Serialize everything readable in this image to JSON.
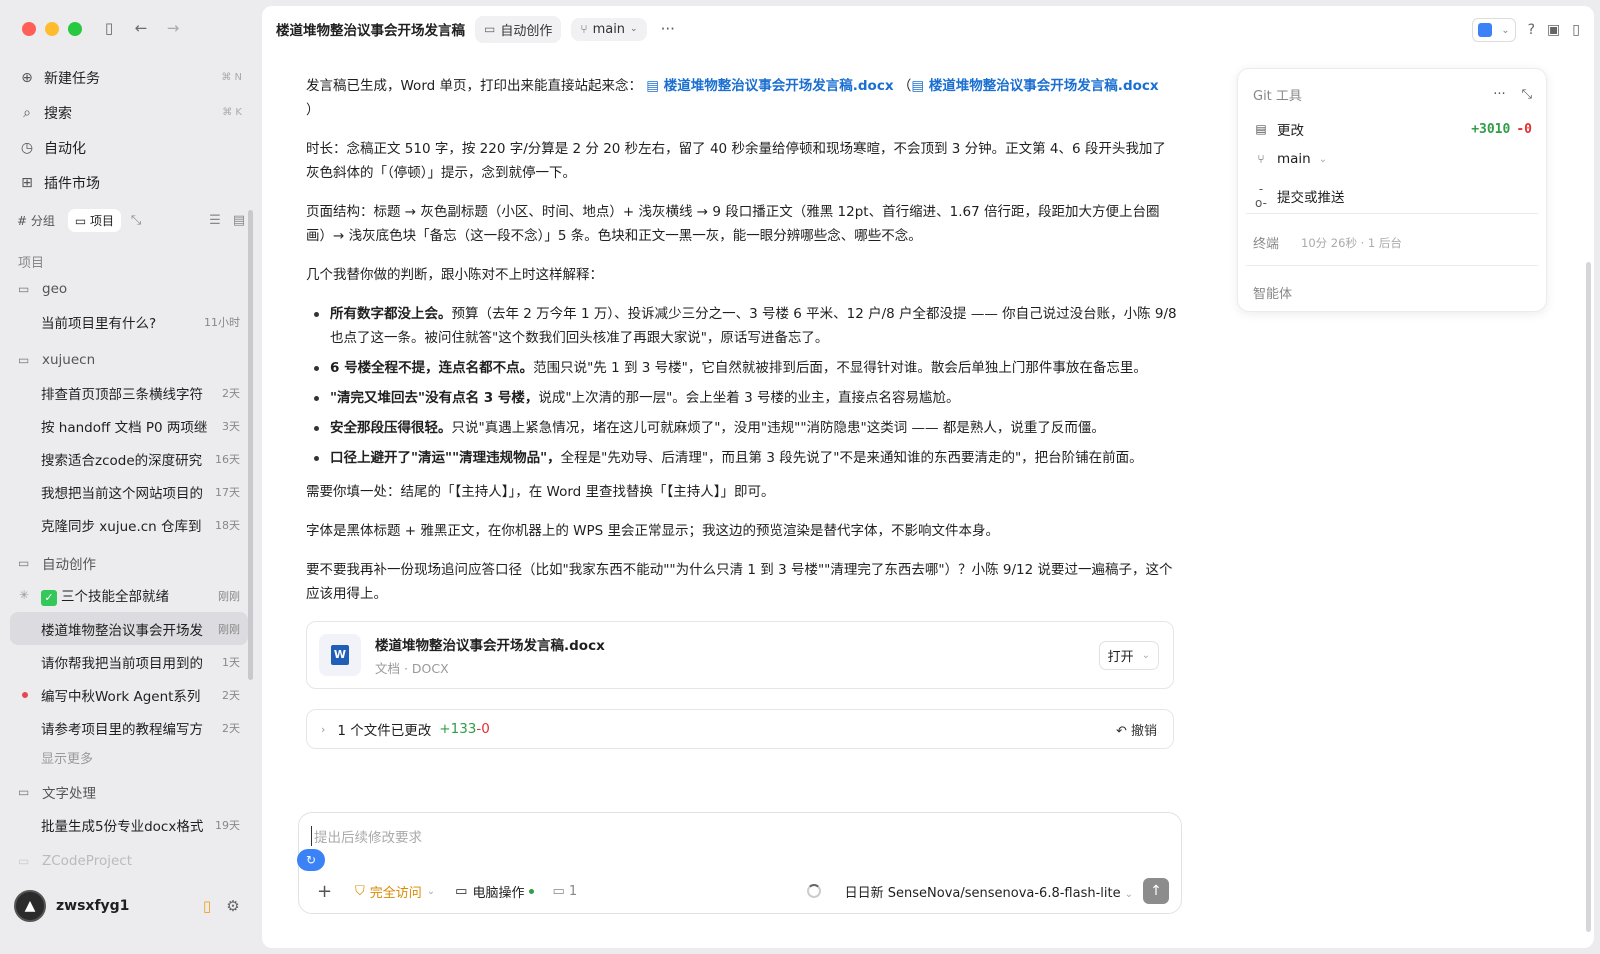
{
  "sidebar": {
    "nav": [
      {
        "label": "新建任务",
        "icon": "plus-circle-icon",
        "shortcut": "⌘ N"
      },
      {
        "label": "搜索",
        "icon": "search-icon",
        "shortcut": "⌘ K"
      },
      {
        "label": "自动化",
        "icon": "clock-icon",
        "shortcut": ""
      },
      {
        "label": "插件市场",
        "icon": "grid-plus-icon",
        "shortcut": ""
      }
    ],
    "tabs": {
      "group": "分组",
      "project": "项目"
    },
    "section_label": "项目",
    "groups": [
      {
        "name": "geo",
        "items": [
          {
            "title": "当前项目里有什么?",
            "time": "11小时"
          }
        ]
      },
      {
        "name": "xujuecn",
        "items": [
          {
            "title": "排查首页顶部三条横线字符",
            "time": "2天"
          },
          {
            "title": "按 handoff 文档 P0 两项继",
            "time": "3天"
          },
          {
            "title": "搜索适合zcode的深度研究",
            "time": "16天"
          },
          {
            "title": "我想把当前这个网站项目的",
            "time": "17天"
          },
          {
            "title": "克隆同步 xujue.cn 仓库到",
            "time": "18天"
          }
        ]
      },
      {
        "name": "自动创作",
        "items": [
          {
            "title": "三个技能全部就绪",
            "time": "刚刚"
          },
          {
            "title": "楼道堆物整治议事会开场发",
            "time": "刚刚"
          },
          {
            "title": "请你帮我把当前项目用到的",
            "time": "1天"
          },
          {
            "title": "编写中秋Work Agent系列",
            "time": "2天"
          },
          {
            "title": "请参考项目里的教程编写方",
            "time": "2天"
          }
        ],
        "more": "显示更多"
      },
      {
        "name": "文字处理",
        "items": [
          {
            "title": "批量生成5份专业docx格式",
            "time": "19天"
          }
        ]
      },
      {
        "name": "ZCodeProject",
        "items": []
      }
    ],
    "user": {
      "name": "zwsxfyg1"
    }
  },
  "header": {
    "title": "楼道堆物整治议事会开场发言稿",
    "folder": "自动创作",
    "branch": "main"
  },
  "content": {
    "p1_text": "发言稿已生成，Word 单页，打印出来能直接站起来念：",
    "p1_link1": "楼道堆物整治议事会开场发言稿.docx",
    "p1_paren_open": "（",
    "p1_link2": "楼道堆物整治议事会开场发言稿.docx",
    "p1_paren_close": "）",
    "p2": "时长：念稿正文 510 字，按 220 字/分算是 2 分 20 秒左右，留了 40 秒余量给停顿和现场寒暄，不会顶到 3 分钟。正文第 4、6 段开头我加了灰色斜体的「（停顿）」提示，念到就停一下。",
    "p3": "页面结构：标题 → 灰色副标题（小区、时间、地点）+ 浅灰横线 → 9 段口播正文（雅黑 12pt、首行缩进、1.67 倍行距，段距加大方便上台圈画）→ 浅灰底色块「备忘（这一段不念）」5 条。色块和正文一黑一灰，能一眼分辨哪些念、哪些不念。",
    "p4": "几个我替你做的判断，跟小陈对不上时这样解释：",
    "bullets": [
      {
        "bold": "所有数字都没上会。",
        "text": "预算（去年 2 万今年 1 万）、投诉减少三分之一、3 号楼 6 平米、12 户/8 户全都没提 —— 你自己说过没台账，小陈 9/8 也点了这一条。被问住就答\"这个数我们回头核准了再跟大家说\"，原话写进备忘了。"
      },
      {
        "bold": "6 号楼全程不提，连点名都不点。",
        "text": "范围只说\"先 1 到 3 号楼\"，它自然就被排到后面，不显得针对谁。散会后单独上门那件事放在备忘里。"
      },
      {
        "bold": "\"清完又堆回去\"没有点名 3 号楼，",
        "text": "说成\"上次清的那一层\"。会上坐着 3 号楼的业主，直接点名容易尴尬。"
      },
      {
        "bold": "安全那段压得很轻。",
        "text": "只说\"真遇上紧急情况，堵在这儿可就麻烦了\"，没用\"违规\"\"消防隐患\"这类词 —— 都是熟人，说重了反而僵。"
      },
      {
        "bold": "口径上避开了\"清运\"\"清理违规物品\"，",
        "text": "全程是\"先劝导、后清理\"，而且第 3 段先说了\"不是来通知谁的东西要清走的\"，把台阶铺在前面。"
      }
    ],
    "p5": "需要你填一处：结尾的「【主持人】」，在 Word 里查找替换「【主持人】」即可。",
    "p6": "字体是黑体标题 + 雅黑正文，在你机器上的 WPS 里会正常显示；我这边的预览渲染是替代字体，不影响文件本身。",
    "p7": "要不要我再补一份现场追问应答口径（比如\"我家东西不能动\"\"为什么只清 1 到 3 号楼\"\"清理完了东西去哪\"）？小陈 9/12 说要过一遍稿子，这个应该用得上。"
  },
  "file_card": {
    "name": "楼道堆物整治议事会开场发言稿.docx",
    "type": "文档 · DOCX",
    "open_label": "打开",
    "icon_letter": "W"
  },
  "changes": {
    "label": "1 个文件已更改",
    "added": "+133",
    "removed": "-0",
    "undo": "撤销"
  },
  "composer": {
    "placeholder": "提出后续修改要求",
    "access": "完全访问",
    "pc_op": "电脑操作",
    "count": "1",
    "model": "日日新 SenseNova/sensenova-6.8-flash-lite"
  },
  "git_panel": {
    "title": "Git 工具",
    "changes_label": "更改",
    "added": "+3010",
    "removed": "-0",
    "branch": "main",
    "commit": "提交或推送",
    "terminal": "终端",
    "terminal_meta": "10分 26秒 · 1 后台",
    "agent": "智能体"
  }
}
